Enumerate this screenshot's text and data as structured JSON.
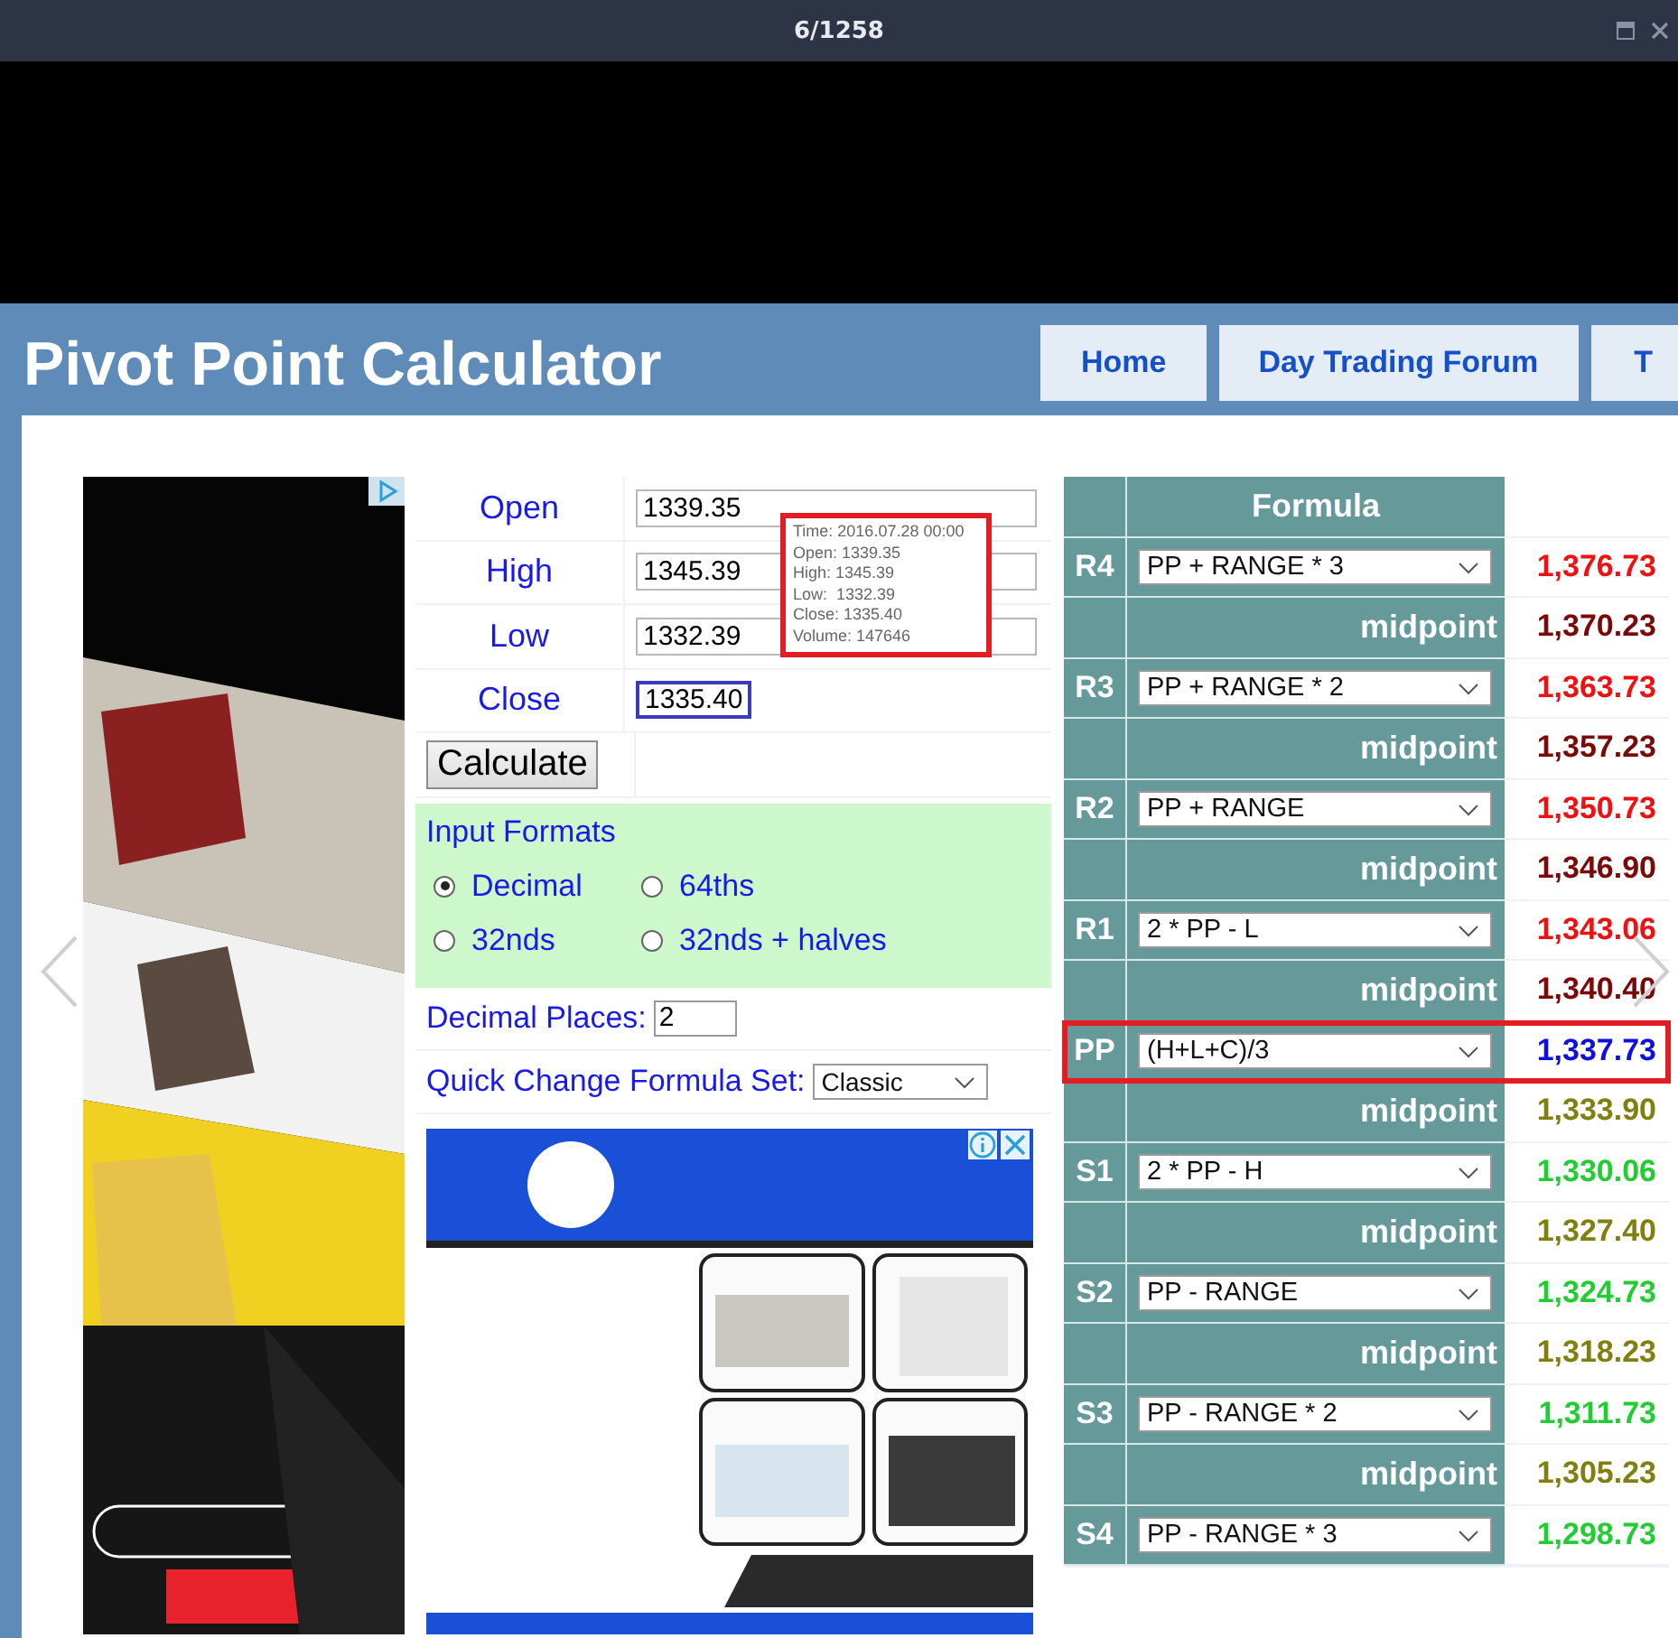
{
  "viewer": {
    "counter": "6/1258"
  },
  "header": {
    "title": "Pivot Point Calculator",
    "nav": [
      {
        "label": "Home"
      },
      {
        "label": "Day Trading Forum"
      },
      {
        "label": "T"
      }
    ]
  },
  "inputs": [
    {
      "label": "Open",
      "value": "1339.35",
      "focused": false
    },
    {
      "label": "High",
      "value": "1345.39",
      "focused": false
    },
    {
      "label": "Low",
      "value": "1332.39",
      "focused": false
    },
    {
      "label": "Close",
      "value": "1335.40",
      "focused": true
    }
  ],
  "tooltip": {
    "lines": [
      "Time: 2016.07.28 00:00",
      "Open: 1339.35",
      "High: 1345.39",
      "Low:  1332.39",
      "Close: 1335.40",
      "Volume: 147646"
    ]
  },
  "calculate_button": "Calculate",
  "input_formats": {
    "title": "Input Formats",
    "options": [
      {
        "label": "Decimal",
        "selected": true
      },
      {
        "label": "64ths",
        "selected": false
      },
      {
        "label": "32nds",
        "selected": false
      },
      {
        "label": "32nds + halves",
        "selected": false
      }
    ]
  },
  "decimal_places": {
    "label": "Decimal Places:",
    "value": "2"
  },
  "formula_set": {
    "label": "Quick Change Formula Set:",
    "value": "Classic"
  },
  "table": {
    "header": "Formula",
    "rows": [
      {
        "kind": "level",
        "label": "R4",
        "formula": "PP + RANGE * 3",
        "value": "1,376.73",
        "color": "#ee1111",
        "highlighted": false
      },
      {
        "kind": "midpoint",
        "formula": "midpoint",
        "value": "1,370.23",
        "color": "#7a0a0a",
        "highlighted": false
      },
      {
        "kind": "level",
        "label": "R3",
        "formula": "PP + RANGE * 2",
        "value": "1,363.73",
        "color": "#ee1111",
        "highlighted": false
      },
      {
        "kind": "midpoint",
        "formula": "midpoint",
        "value": "1,357.23",
        "color": "#7a0a0a",
        "highlighted": false
      },
      {
        "kind": "level",
        "label": "R2",
        "formula": "PP + RANGE",
        "value": "1,350.73",
        "color": "#ee1111",
        "highlighted": false
      },
      {
        "kind": "midpoint",
        "formula": "midpoint",
        "value": "1,346.90",
        "color": "#7a0a0a",
        "highlighted": false
      },
      {
        "kind": "level",
        "label": "R1",
        "formula": "2 * PP - L",
        "value": "1,343.06",
        "color": "#ee1111",
        "highlighted": false
      },
      {
        "kind": "midpoint",
        "formula": "midpoint",
        "value": "1,340.40",
        "color": "#7a0a0a",
        "highlighted": false
      },
      {
        "kind": "level",
        "label": "PP",
        "formula": "(H+L+C)/3",
        "value": "1,337.73",
        "color": "#1010dd",
        "highlighted": true
      },
      {
        "kind": "midpoint",
        "formula": "midpoint",
        "value": "1,333.90",
        "color": "#808010",
        "highlighted": false
      },
      {
        "kind": "level",
        "label": "S1",
        "formula": "2 * PP - H",
        "value": "1,330.06",
        "color": "#22cc33",
        "highlighted": false
      },
      {
        "kind": "midpoint",
        "formula": "midpoint",
        "value": "1,327.40",
        "color": "#808010",
        "highlighted": false
      },
      {
        "kind": "level",
        "label": "S2",
        "formula": "PP - RANGE",
        "value": "1,324.73",
        "color": "#22cc33",
        "highlighted": false
      },
      {
        "kind": "midpoint",
        "formula": "midpoint",
        "value": "1,318.23",
        "color": "#808010",
        "highlighted": false
      },
      {
        "kind": "level",
        "label": "S3",
        "formula": "PP - RANGE * 2",
        "value": "1,311.73",
        "color": "#22cc33",
        "highlighted": false
      },
      {
        "kind": "midpoint",
        "formula": "midpoint",
        "value": "1,305.23",
        "color": "#808010",
        "highlighted": false
      },
      {
        "kind": "level",
        "label": "S4",
        "formula": "PP - RANGE * 3",
        "value": "1,298.73",
        "color": "#22cc33",
        "highlighted": false
      }
    ]
  }
}
